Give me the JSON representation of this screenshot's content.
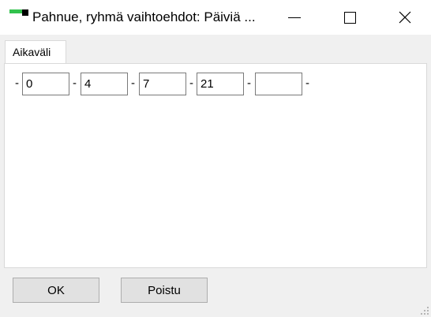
{
  "window": {
    "title": "Pahnue, ryhmä vaihtoehdot: Päiviä ...",
    "colors": {
      "icon_accent": "#33c24d",
      "titlebar_bg": "#ffffff",
      "client_bg": "#f0f0f0"
    }
  },
  "tabs": [
    {
      "label": "Aikaväli",
      "selected": true
    }
  ],
  "intervals": {
    "separator": "-",
    "fields": [
      "0",
      "4",
      "7",
      "21",
      ""
    ]
  },
  "buttons": {
    "ok_label": "OK",
    "quit_label": "Poistu"
  },
  "icons": {
    "minimize": "minimize-icon",
    "maximize": "maximize-icon",
    "close": "close-icon",
    "resize": "resize-grip-icon"
  }
}
